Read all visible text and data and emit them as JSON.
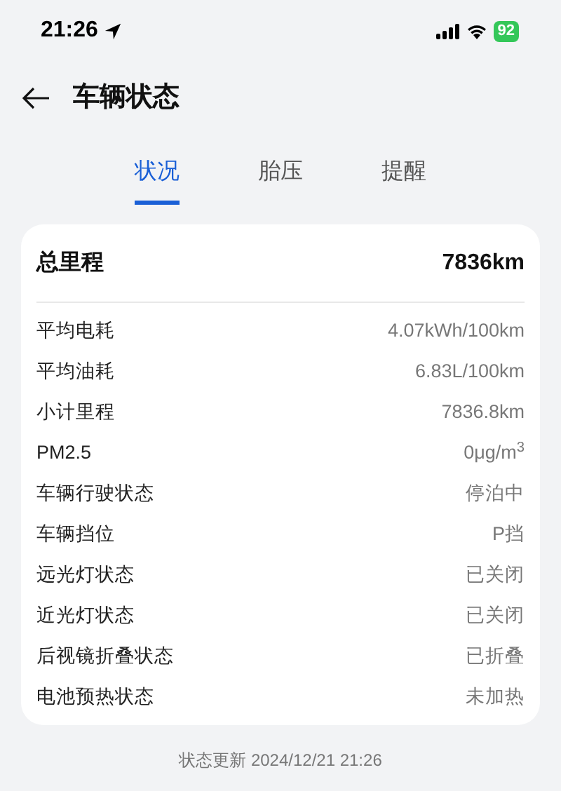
{
  "status_bar": {
    "time": "21:26",
    "battery": "92"
  },
  "header": {
    "title": "车辆状态"
  },
  "tabs": [
    {
      "label": "状况",
      "selected": true
    },
    {
      "label": "胎压",
      "selected": false
    },
    {
      "label": "提醒",
      "selected": false
    }
  ],
  "summary": {
    "label": "总里程",
    "value": "7836km"
  },
  "rows": [
    {
      "label": "平均电耗",
      "value": "4.07kWh/100km"
    },
    {
      "label": "平均油耗",
      "value": "6.83L/100km"
    },
    {
      "label": "小计里程",
      "value": "7836.8km"
    },
    {
      "label": "PM2.5",
      "value": "0μg/m$^{3}$"
    },
    {
      "label": "车辆行驶状态",
      "value": "停泊中"
    },
    {
      "label": "车辆挡位",
      "value": "P挡"
    },
    {
      "label": "远光灯状态",
      "value": "已关闭"
    },
    {
      "label": "近光灯状态",
      "value": "已关闭"
    },
    {
      "label": "后视镜折叠状态",
      "value": "已折叠"
    },
    {
      "label": "电池预热状态",
      "value": "未加热"
    }
  ],
  "footer": {
    "updated": "状态更新 2024/12/21 21:26"
  }
}
